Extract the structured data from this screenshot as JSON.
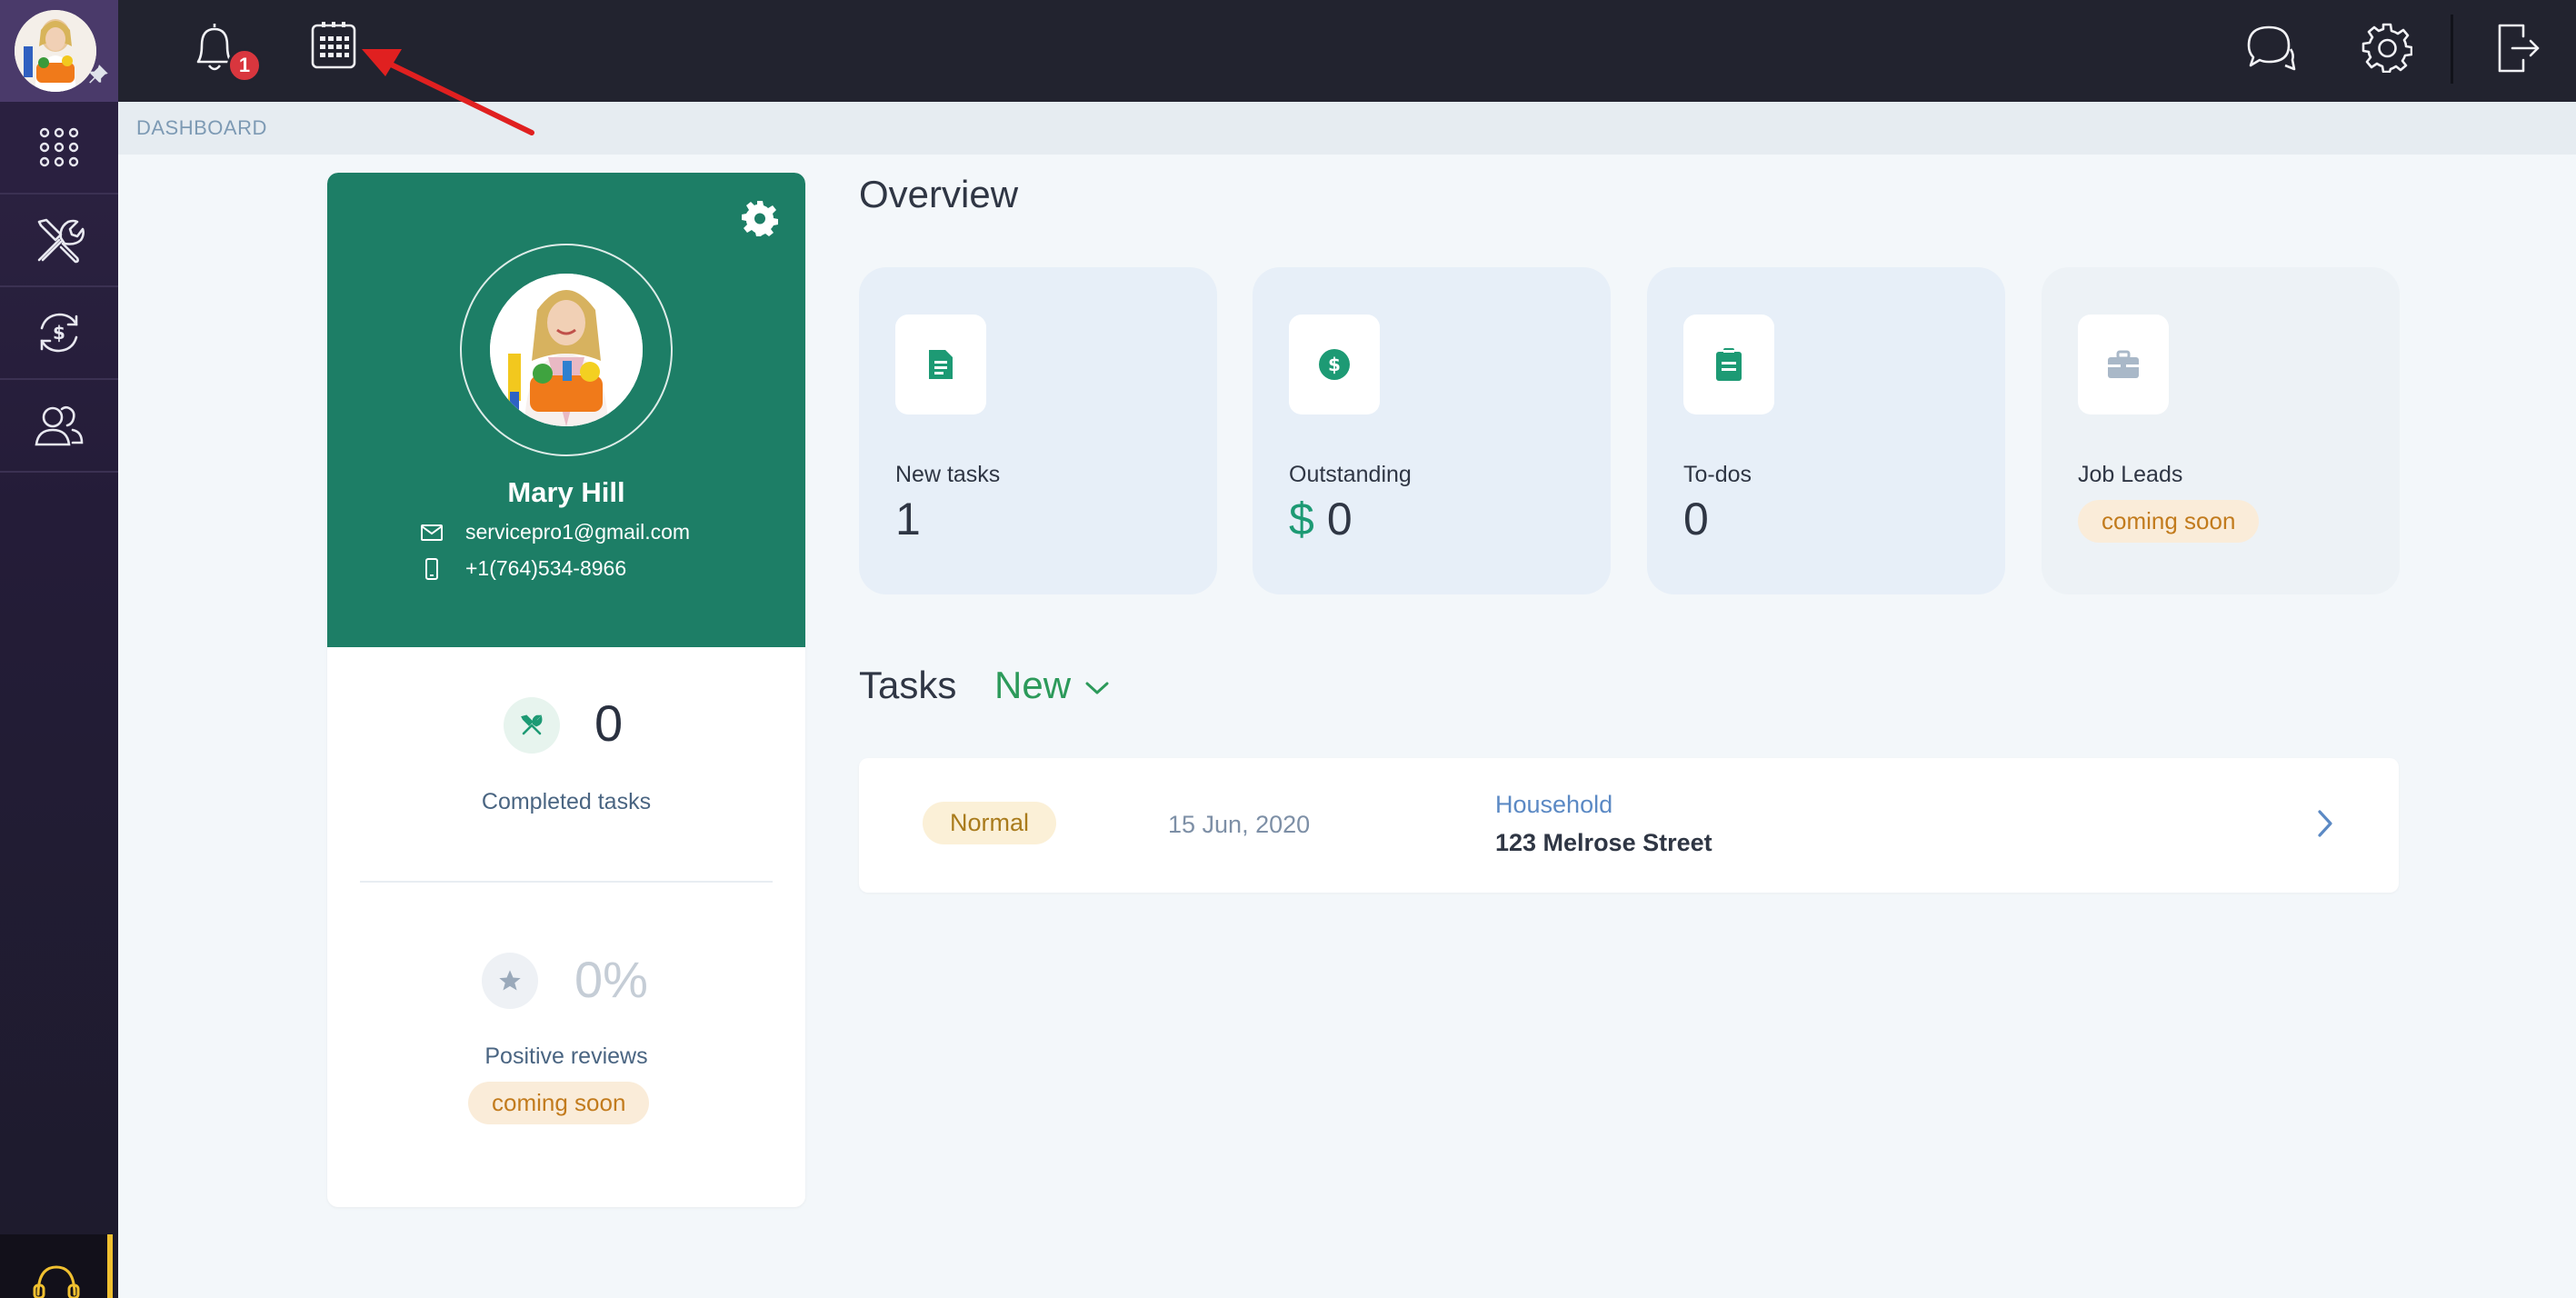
{
  "topbar": {
    "notification_count": "1",
    "icons": [
      "bell-icon",
      "calendar-icon",
      "chat-icon",
      "gear-icon",
      "logout-icon"
    ]
  },
  "sidebar": {
    "items": [
      {
        "icon": "apps-grid-icon"
      },
      {
        "icon": "tools-icon"
      },
      {
        "icon": "payments-cycle-icon"
      },
      {
        "icon": "users-icon"
      }
    ],
    "support_icon": "headset-icon"
  },
  "breadcrumb": "DASHBOARD",
  "profile": {
    "name": "Mary Hill",
    "email": "servicepro1@gmail.com",
    "phone": "+1(764)534-8966",
    "completed_tasks_value": "0",
    "completed_tasks_label": "Completed tasks",
    "reviews_value": "0%",
    "reviews_label": "Positive reviews",
    "reviews_status": "coming soon"
  },
  "overview": {
    "title": "Overview",
    "cards": [
      {
        "label": "New tasks",
        "value": "1",
        "icon": "document-icon"
      },
      {
        "label": "Outstanding",
        "currency": "$",
        "value": "0",
        "icon": "dollar-icon"
      },
      {
        "label": "To-dos",
        "value": "0",
        "icon": "clipboard-icon"
      },
      {
        "label": "Job Leads",
        "status": "coming soon",
        "icon": "briefcase-icon"
      }
    ]
  },
  "tasks": {
    "title": "Tasks",
    "filter": "New",
    "rows": [
      {
        "priority": "Normal",
        "date": "15 Jun, 2020",
        "category": "Household",
        "address": "123 Melrose Street"
      }
    ]
  },
  "colors": {
    "sidebar": "#2a2040",
    "topbar": "#22232f",
    "profile_green": "#1d7e66",
    "accent_green": "#1d9a74",
    "filter_green": "#2c9a5a",
    "badge_red": "#d9363e",
    "annotation_red": "#e02020"
  }
}
